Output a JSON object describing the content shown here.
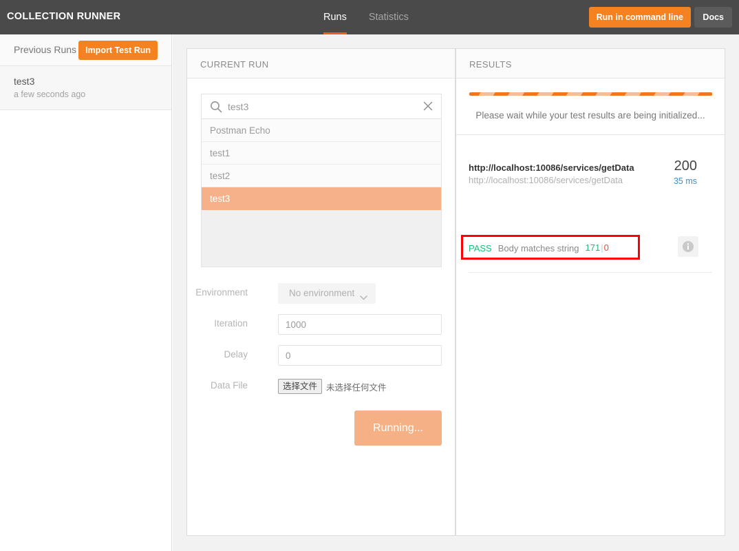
{
  "header": {
    "app_title": "COLLECTION RUNNER",
    "tabs": [
      {
        "label": "Runs",
        "active": true
      },
      {
        "label": "Statistics",
        "active": false
      }
    ],
    "run_command_line_label": "Run in command line",
    "docs_label": "Docs",
    "accent_color": "#f58220",
    "background_color": "#4a4a4a"
  },
  "sidebar": {
    "title": "Previous Runs",
    "import_label": "Import Test Run",
    "runs": [
      {
        "name": "test3",
        "time": "a few seconds ago"
      }
    ]
  },
  "current_run": {
    "panel_title": "CURRENT RUN",
    "search": {
      "value": "test3",
      "placeholder": "Search",
      "search_icon": "search-icon",
      "clear_icon": "close-icon"
    },
    "requests": [
      {
        "label": "Postman Echo",
        "selected": false
      },
      {
        "label": "test1",
        "selected": false
      },
      {
        "label": "test2",
        "selected": false
      },
      {
        "label": "test3",
        "selected": true
      }
    ],
    "form": {
      "environment_label": "Environment",
      "environment_value": "No environment",
      "environment_icon": "chevron-down-icon",
      "iteration_label": "Iteration",
      "iteration_value": "1000",
      "delay_label": "Delay",
      "delay_value": "0",
      "data_file_label": "Data File",
      "data_file_button": "选择文件",
      "data_file_status": "未选择任何文件"
    },
    "run_button_label": "Running...",
    "selected_color": "#f7b188"
  },
  "results": {
    "panel_title": "RESULTS",
    "progress_message": "Please wait while your test results are being initialized...",
    "progress_colors": {
      "dark": "#ee7723",
      "light": "#f7bd97"
    },
    "entry": {
      "url_main": "http://localhost:10086/services/getData",
      "url_sub": "http://localhost:10086/services/getData",
      "status_code": "200",
      "response_time": "35 ms",
      "info_icon": "info-icon",
      "assertion": {
        "result": "PASS",
        "name": "Body matches string",
        "pass_count": "171",
        "divider": "|",
        "fail_count": "0",
        "pass_color": "#1abc7b",
        "fail_color": "#e74c3c"
      },
      "highlight_color": "#fb0006"
    }
  }
}
